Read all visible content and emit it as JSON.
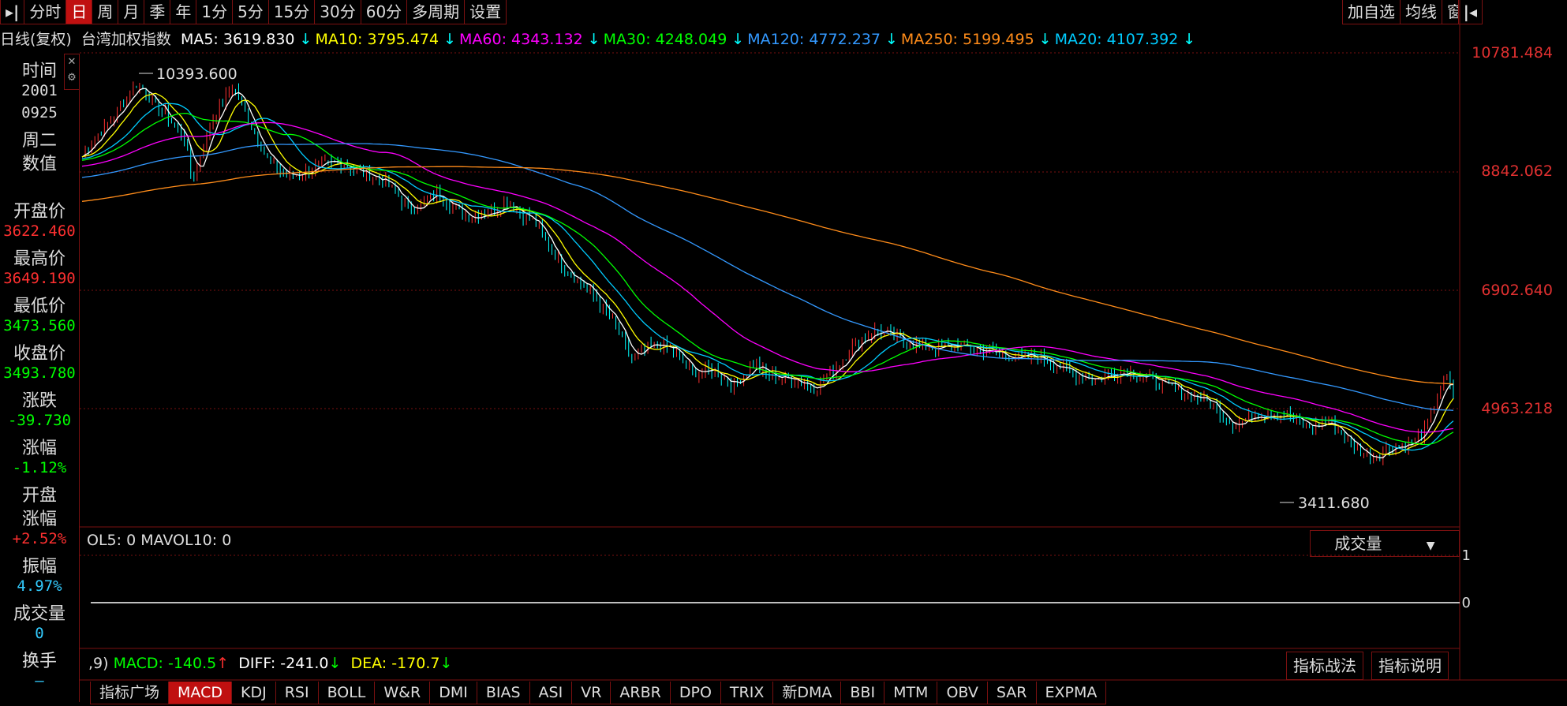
{
  "toolbar": {
    "tabs": [
      "分时",
      "日",
      "周",
      "月",
      "季",
      "年",
      "1分",
      "5分",
      "15分",
      "30分",
      "60分",
      "多周期",
      "设置"
    ],
    "active_tab": "日",
    "right_buttons": [
      "加自选",
      "均线",
      "窗"
    ]
  },
  "legend": {
    "period": "日线(复权)",
    "instrument": "台湾加权指数",
    "ma": [
      {
        "label": "MA5: 3619.830",
        "arrow": "↓",
        "color": "#ffffff"
      },
      {
        "label": "MA10: 3795.474",
        "arrow": "↓",
        "color": "#ffff00"
      },
      {
        "label": "MA60: 4343.132",
        "arrow": "↓",
        "color": "#ff00ff"
      },
      {
        "label": "MA30: 4248.049",
        "arrow": "↓",
        "color": "#00ff00"
      },
      {
        "label": "MA120: 4772.237",
        "arrow": "↓",
        "color": "#3399ff"
      },
      {
        "label": "MA250: 5199.495",
        "arrow": "↓",
        "color": "#ff8c1a"
      },
      {
        "label": "MA20: 4107.392",
        "arrow": "↓",
        "color": "#00ccff"
      }
    ]
  },
  "info_panel": {
    "time_label": "时间",
    "date_year": "2001",
    "date_md": "0925",
    "weekday": "周二",
    "value_label": "数值",
    "open_label": "开盘价",
    "open": "3622.460",
    "high_label": "最高价",
    "high": "3649.190",
    "low_label": "最低价",
    "low": "3473.560",
    "close_label": "收盘价",
    "close": "3493.780",
    "change_label": "涨跌",
    "change": "-39.730",
    "pct_label": "涨幅",
    "pct": "-1.12%",
    "open_pct_label1": "开盘",
    "open_pct_label2": "涨幅",
    "open_pct": "+2.52%",
    "amp_label": "振幅",
    "amp": "4.97%",
    "vol_label": "成交量",
    "vol": "0",
    "turnover_label": "换手",
    "turnover": "—"
  },
  "price_axis": [
    "10781.484",
    "8842.062",
    "6902.640",
    "4963.218"
  ],
  "annotations": {
    "high_mark": "10393.600",
    "low_mark": "3411.680"
  },
  "volume_panel": {
    "header": "OL5: 0 MAVOL10: 0",
    "dropdown": "成交量",
    "axis": [
      "1",
      "0"
    ]
  },
  "macd_panel": {
    "prefix": ",9)",
    "macd": "MACD: -140.5",
    "macd_arrow": "↑",
    "diff": "DIFF: -241.0",
    "diff_arrow": "↓",
    "dea": "DEA: -170.7",
    "dea_arrow": "↓",
    "btn_strategy": "指标战法",
    "btn_help": "指标说明"
  },
  "bottom_tabs": [
    "指标广场",
    "MACD",
    "KDJ",
    "RSI",
    "BOLL",
    "W&R",
    "DMI",
    "BIAS",
    "ASI",
    "VR",
    "ARBR",
    "DPO",
    "TRIX",
    "新DMA",
    "BBI",
    "MTM",
    "OBV",
    "SAR",
    "EXPMA"
  ],
  "bottom_active": "MACD",
  "colors": {
    "up": "#ff3030",
    "down": "#00ff00",
    "axis": "#e03030",
    "border": "#7a1010",
    "accent": "#c01010"
  }
}
